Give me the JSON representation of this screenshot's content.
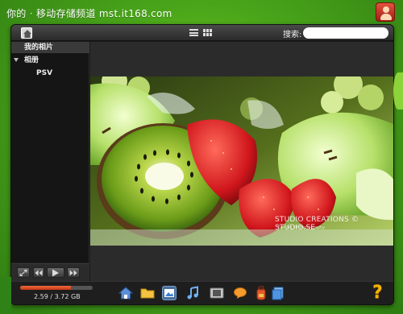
{
  "banner": {
    "title_prefix": "你的",
    "bullet": "·",
    "title_main": "移动存储频道",
    "url": "mst.it168.com"
  },
  "toolbar": {
    "search_label": "搜索:",
    "search_value": ""
  },
  "sidebar": {
    "root_label": "我的相片",
    "album_label": "相册",
    "album_child_label": "PSV"
  },
  "photo": {
    "watermark": "STUDIO CREATIONS © STUDIO.SE",
    "watermark_sub": "The Art Of Photography"
  },
  "storage": {
    "text": "2.59 / 3.72 GB",
    "used_gb": 2.59,
    "total_gb": 3.72
  },
  "help": {
    "label": "?"
  },
  "dock_icons": [
    "home-icon",
    "folder-icon",
    "photos-icon",
    "music-icon",
    "video-icon",
    "chat-icon",
    "backpack-icon",
    "documents-icon"
  ],
  "colors": {
    "accent_orange": "#e0502a",
    "help_yellow": "#f5b400",
    "active_blue": "#4a6f9a"
  }
}
